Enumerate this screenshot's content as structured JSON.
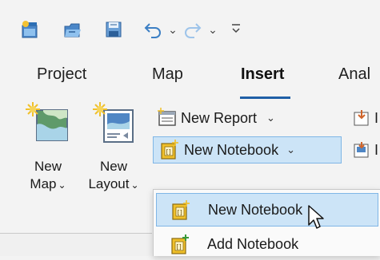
{
  "qat": {
    "icons": [
      "new-project-icon",
      "open-project-icon",
      "save-project-icon",
      "undo-icon",
      "undo-dropdown-icon",
      "redo-icon",
      "redo-dropdown-icon",
      "customize-qat-icon"
    ],
    "dropdown_glyph": "⌄",
    "customize_glyph": "⌄"
  },
  "tabs": {
    "project": "Project",
    "map": "Map",
    "insert": "Insert",
    "analysis_partial": "Anal"
  },
  "ribbon": {
    "new_map_line1": "New",
    "new_map_line2": "Map",
    "new_layout_line1": "New",
    "new_layout_line2": "Layout",
    "chev": "⌄",
    "new_report": "New Report",
    "new_notebook": "New Notebook",
    "partial_right_1": "I",
    "partial_right_2": "I"
  },
  "dropdown": {
    "items": [
      {
        "label": "New Notebook"
      },
      {
        "label": "Add Notebook"
      }
    ]
  },
  "colors": {
    "accent": "#1f5fa6",
    "highlight": "#cce4f7",
    "highlight_border": "#7fb6e6",
    "notebook_yellow": "#f0c02a"
  }
}
